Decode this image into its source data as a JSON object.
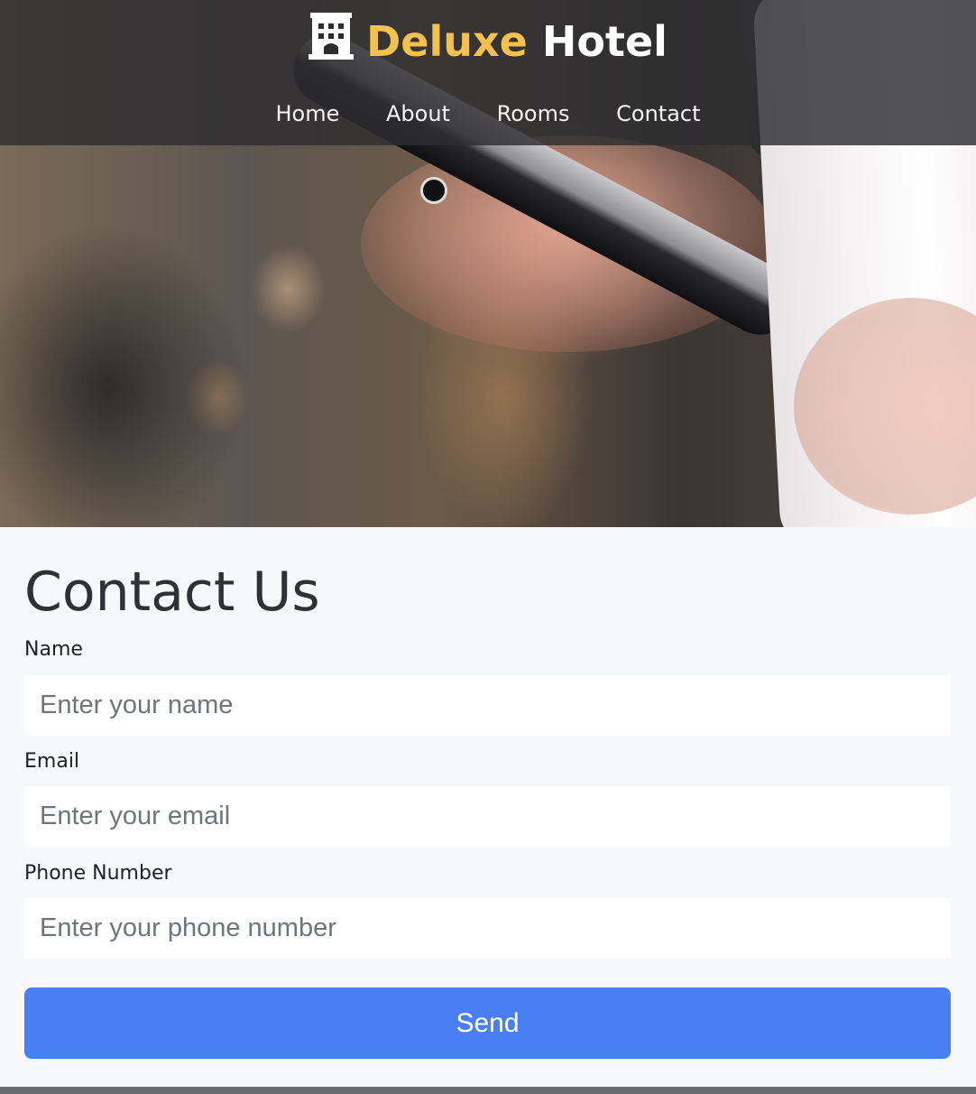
{
  "brand": {
    "icon": "hotel-icon",
    "accent_word": "Deluxe",
    "main_word": "Hotel",
    "accent_color": "#f2c14e"
  },
  "nav": {
    "items": [
      {
        "label": "Home"
      },
      {
        "label": "About"
      },
      {
        "label": "Rooms"
      },
      {
        "label": "Contact"
      }
    ]
  },
  "hero": {
    "image": "hand holding smartphone and coffee cup"
  },
  "contact": {
    "title": "Contact Us",
    "fields": [
      {
        "label": "Name",
        "placeholder": "Enter your name",
        "value": ""
      },
      {
        "label": "Email",
        "placeholder": "Enter your email",
        "value": ""
      },
      {
        "label": "Phone Number",
        "placeholder": "Enter your phone number",
        "value": ""
      }
    ],
    "submit_label": "Send",
    "submit_color": "#4a7ff3"
  }
}
